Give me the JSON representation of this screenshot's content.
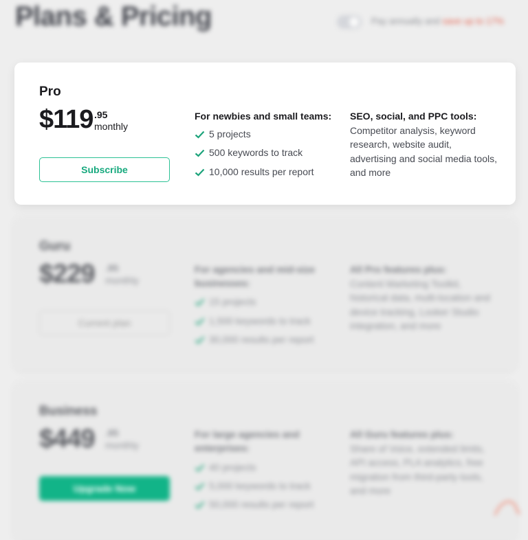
{
  "header": {
    "title": "Plans & Pricing",
    "toggle_label": "Pay annually and",
    "toggle_save": "save up to 17%"
  },
  "plans": [
    {
      "name": "Pro",
      "price": "$119",
      "cents": ".95",
      "period": "monthly",
      "button": "Subscribe",
      "features_title": "For newbies and small teams:",
      "features": [
        "5 projects",
        "500 keywords to track",
        "10,000 results per report"
      ],
      "tools_title": "SEO, social, and PPC tools:",
      "tools": "Competitor analysis, keyword research, website audit, advertising and social media tools, and more"
    },
    {
      "name": "Guru",
      "price": "$229",
      "cents": ".95",
      "period": "monthly",
      "button": "Current plan",
      "features_title": "For agencies and mid-size businesses:",
      "features": [
        "15 projects",
        "1,500 keywords to track",
        "30,000 results per report"
      ],
      "tools_title": "All Pro features plus:",
      "tools": "Content Marketing Toolkit, historical data, multi-location and device tracking, Looker Studio integration, and more"
    },
    {
      "name": "Business",
      "price": "$449",
      "cents": ".95",
      "period": "monthly",
      "button": "Upgrade Now",
      "features_title": "For large agencies and enterprises:",
      "features": [
        "40 projects",
        "5,000 keywords to track",
        "50,000 results per report"
      ],
      "tools_title": "All Guru features plus:",
      "tools": "Share of Voice, extended limits, API access, PLA analytics, free migration from third-party tools, and more"
    }
  ],
  "colors": {
    "accent": "#12b488",
    "check": "#1ba37a",
    "save": "#e4614e"
  }
}
